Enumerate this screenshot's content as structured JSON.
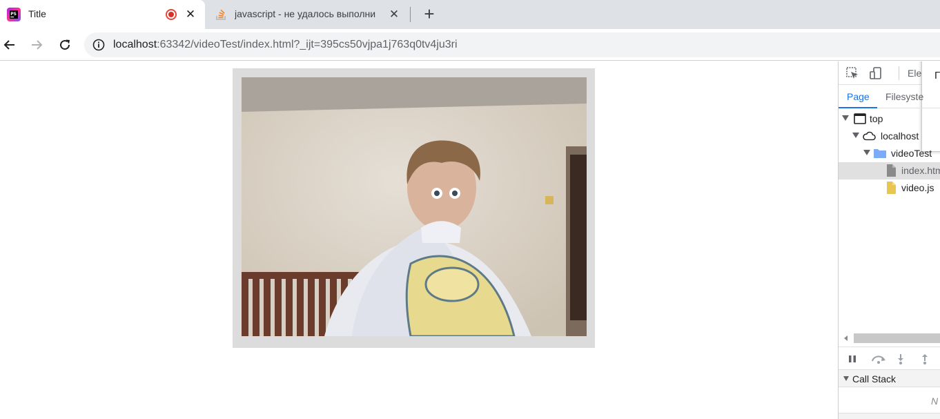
{
  "tabs": [
    {
      "title": "Title",
      "favicon": "phpstorm-icon",
      "active": true,
      "recording": true,
      "close": "✕"
    },
    {
      "title": "javascript - не удалось выполни",
      "favicon": "stackoverflow-icon",
      "active": false,
      "close": "✕"
    }
  ],
  "new_tab": "+",
  "address_bar": {
    "host": "localhost",
    "rest": ":63342/videoTest/index.html?_ijt=395cs50vjpa1j763q0tv4ju3ri"
  },
  "page": {
    "video_description": "webcam video stream"
  },
  "devtools": {
    "main_tab": "Ele",
    "popup_text": "Г",
    "subtabs": [
      "Page",
      "Filesyste"
    ],
    "tree": [
      {
        "label": "top",
        "icon": "frame-icon",
        "level": 0,
        "expanded": true
      },
      {
        "label": "localhost",
        "icon": "cloud-icon",
        "level": 1,
        "expanded": true
      },
      {
        "label": "videoTest",
        "icon": "folder-icon",
        "level": 2,
        "expanded": true
      },
      {
        "label": "index.htm",
        "icon": "html-file-icon",
        "level": 3,
        "selected": true
      },
      {
        "label": "video.js",
        "icon": "js-file-icon",
        "level": 3
      }
    ],
    "call_stack_label": "Call Stack",
    "call_stack_empty": "N"
  },
  "colors": {
    "tabstrip": "#dee1e6",
    "omnibox": "#f1f3f4",
    "accent": "#1a73e8",
    "record": "#d93025"
  }
}
